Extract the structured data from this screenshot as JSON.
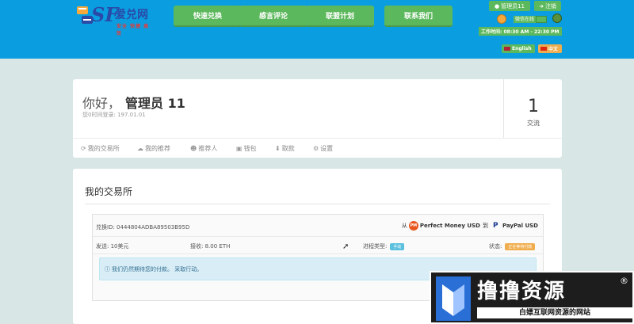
{
  "header": {
    "logo": {
      "sf": "SF",
      "name": "爱兑网",
      "sub": "安全 快捷 高效"
    },
    "nav": [
      "快速兑换",
      "感言评论",
      "联盟计划",
      "联系我们"
    ],
    "user_button": "管理员11",
    "logout_button": "注销",
    "online_label": "微信在线",
    "hours": "工作时间: 08:30 AM - 22:30 PM",
    "lang_en": "English",
    "lang_zh": "中文"
  },
  "profile": {
    "greeting": "你好，",
    "username": "管理员 11",
    "last_login": "您0时间登录: 197.01.01",
    "stat_value": "1",
    "stat_label": "交流",
    "tabs": [
      {
        "icon": "refresh-icon",
        "glyph": "⟳",
        "label": "我的交易所"
      },
      {
        "icon": "comments-icon",
        "glyph": "💬",
        "label": "我的推荐"
      },
      {
        "icon": "users-icon",
        "glyph": "👥",
        "label": "推荐人"
      },
      {
        "icon": "wallet-icon",
        "glyph": "▣",
        "label": "钱包"
      },
      {
        "icon": "download-icon",
        "glyph": "⬇",
        "label": "取款"
      },
      {
        "icon": "settings-icon",
        "glyph": "⚙",
        "label": "设置"
      }
    ]
  },
  "exchanges": {
    "title": "我的交易所",
    "item": {
      "id_label": "兑换ID: 0444804ADBA89503B95D",
      "from_label": "从",
      "from_currency": "Perfect Money USD",
      "to_label": "到",
      "to_currency": "PayPal USD",
      "send": "发送: 10美元",
      "receive": "接收: 8.00 ETH",
      "type_label": "进程类型:",
      "type_value": "手动",
      "status_label": "状态:",
      "status_value": "正在等待付款",
      "info": "我们仍然期待您的付款。         采取行动。"
    }
  },
  "watermark": {
    "big": "撸撸资源",
    "reg": "®",
    "small": "白嫖互联网资源的网站"
  },
  "colors": {
    "header_bg": "#0a9ee0",
    "nav_green": "#5cb85c",
    "page_bg": "#d9e6e6",
    "info_bg": "#d9edf7",
    "status_orange": "#f0ad4e"
  }
}
